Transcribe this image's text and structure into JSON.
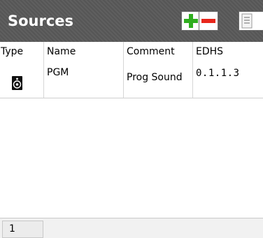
{
  "panel": {
    "title": "Sources",
    "header_color": "#595959",
    "buttons": {
      "add": {
        "icon": "plus-icon",
        "color": "#2fae1f"
      },
      "remove": {
        "icon": "minus-icon",
        "color": "#e8261b"
      },
      "list": {
        "icon": "list-icon"
      }
    }
  },
  "table": {
    "columns": [
      "Type",
      "Name",
      "Comment",
      "EDHS"
    ],
    "rows": [
      {
        "type_icon": "speaker-icon",
        "name": "PGM",
        "comment": "Prog Sound",
        "edhs": "0.1.1.3"
      }
    ]
  },
  "footer": {
    "page": "1"
  }
}
